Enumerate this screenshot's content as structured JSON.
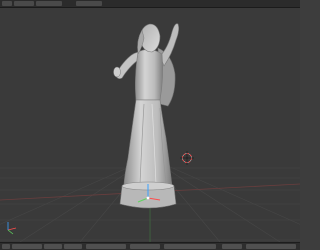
{
  "app": {
    "top_menu": {
      "left_label": "",
      "mid_label": "",
      "right_info": ""
    }
  },
  "viewport": {
    "view_label": "",
    "units_label": "",
    "active_object": ""
  },
  "bottom_toolbar": {
    "mode": "",
    "pivot": "",
    "layer_info": ""
  },
  "colors": {
    "background": "#3a3a3a",
    "grid": "#4a4a4a",
    "grid_x_axis": "#7a4a4a",
    "grid_y_axis": "#4a7a4a",
    "mesh": "#c8c8c8",
    "cursor": "#ff4d4d"
  },
  "icons": [
    "3d-cursor-icon",
    "transform-manipulator-icon"
  ]
}
